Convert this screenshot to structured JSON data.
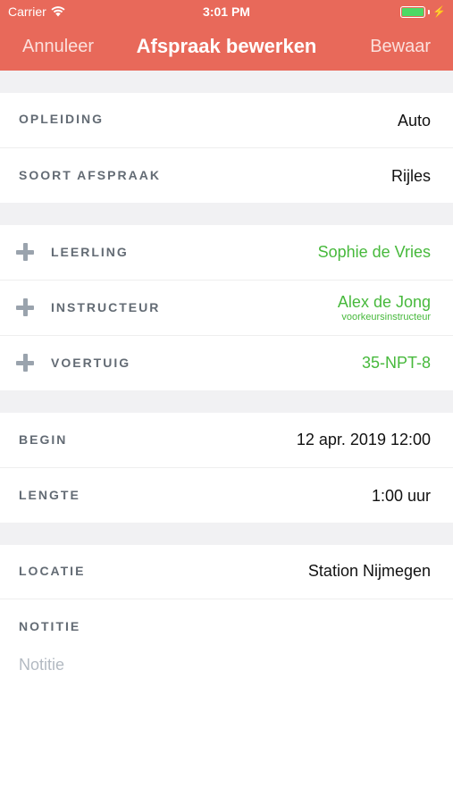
{
  "status_bar": {
    "carrier": "Carrier",
    "time": "3:01 PM",
    "battery_level": 1.0
  },
  "nav": {
    "cancel": "Annuleer",
    "title": "Afspraak bewerken",
    "save": "Bewaar"
  },
  "sections": {
    "opleiding": {
      "label": "OPLEIDING",
      "value": "Auto"
    },
    "soort": {
      "label": "SOORT AFSPRAAK",
      "value": "Rijles"
    },
    "leerling": {
      "label": "LEERLING",
      "value": "Sophie de Vries"
    },
    "instructeur": {
      "label": "INSTRUCTEUR",
      "value": "Alex de Jong",
      "sub": "voorkeursinstructeur"
    },
    "voertuig": {
      "label": "VOERTUIG",
      "value": "35-NPT-8"
    },
    "begin": {
      "label": "BEGIN",
      "value": "12 apr. 2019 12:00"
    },
    "lengte": {
      "label": "LENGTE",
      "value": "1:00 uur"
    },
    "locatie": {
      "label": "LOCATIE",
      "value": "Station Nijmegen"
    },
    "notitie": {
      "label": "NOTITIE",
      "placeholder": "Notitie",
      "value": ""
    }
  },
  "colors": {
    "header": "#e8695a",
    "accent_green": "#47b93c",
    "battery": "#4cd964"
  }
}
